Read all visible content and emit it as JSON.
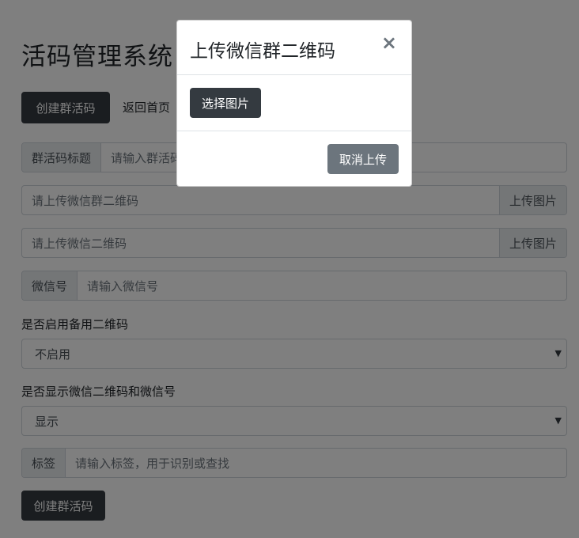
{
  "page": {
    "title": "活码管理系统",
    "nav": {
      "create": "创建群活码",
      "home": "返回首页"
    },
    "form": {
      "title_group": {
        "label": "群活码标题",
        "placeholder": "请输入群活码标题"
      },
      "group_qr": {
        "placeholder": "请上传微信群二维码",
        "button": "上传图片"
      },
      "wx_qr": {
        "placeholder": "请上传微信二维码",
        "button": "上传图片"
      },
      "wechat_id": {
        "label": "微信号",
        "placeholder": "请输入微信号"
      },
      "backup_label": "是否启用备用二维码",
      "backup_value": "不启用",
      "display_label": "是否显示微信二维码和微信号",
      "display_value": "显示",
      "tag": {
        "label": "标签",
        "placeholder": "请输入标签，用于识别或查找"
      },
      "submit": "创建群活码"
    }
  },
  "modal": {
    "title": "上传微信群二维码",
    "close": "×",
    "choose": "选择图片",
    "cancel": "取消上传"
  },
  "icons": {
    "caret": "caret-down-icon",
    "close": "close-icon"
  },
  "colors": {
    "dark": "#343a40",
    "secondary": "#6c757d",
    "backdrop": "rgba(0,0,0,0.5)"
  }
}
